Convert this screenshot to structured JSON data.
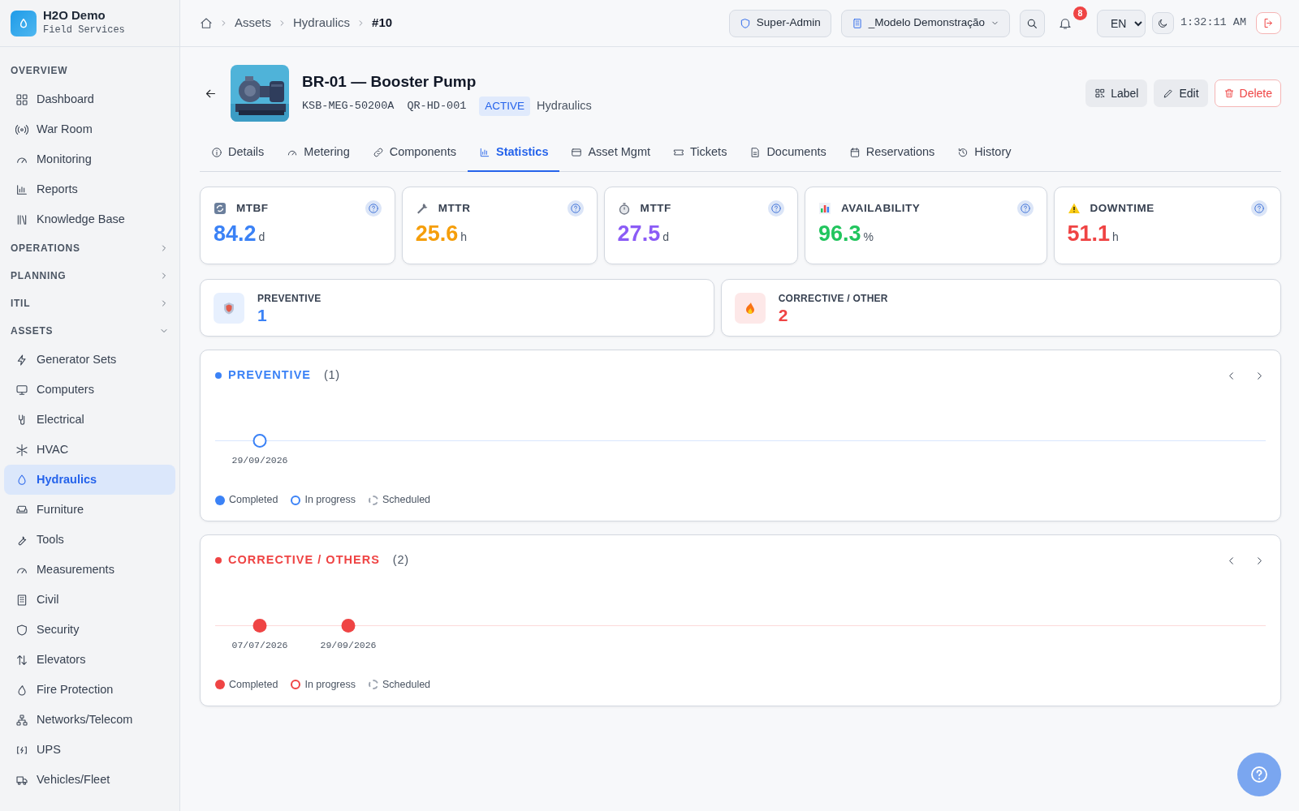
{
  "brand": {
    "name": "H2O Demo",
    "subtitle": "Field Services"
  },
  "sidebar": {
    "sections": [
      {
        "title": "OVERVIEW",
        "kind": "heading",
        "items": [
          {
            "label": "Dashboard",
            "selected": false
          },
          {
            "label": "War Room",
            "selected": false
          },
          {
            "label": "Monitoring",
            "selected": false
          },
          {
            "label": "Reports",
            "selected": false
          },
          {
            "label": "Knowledge Base",
            "selected": false
          }
        ]
      },
      {
        "title": "OPERATIONS",
        "kind": "group",
        "expanded": false
      },
      {
        "title": "PLANNING",
        "kind": "group",
        "expanded": false
      },
      {
        "title": "ITIL",
        "kind": "group",
        "expanded": false
      },
      {
        "title": "ASSETS",
        "kind": "group",
        "expanded": true,
        "items": [
          {
            "label": "Generator Sets",
            "selected": false
          },
          {
            "label": "Computers",
            "selected": false
          },
          {
            "label": "Electrical",
            "selected": false
          },
          {
            "label": "HVAC",
            "selected": false
          },
          {
            "label": "Hydraulics",
            "selected": true
          },
          {
            "label": "Furniture",
            "selected": false
          },
          {
            "label": "Tools",
            "selected": false
          },
          {
            "label": "Measurements",
            "selected": false
          },
          {
            "label": "Civil",
            "selected": false
          },
          {
            "label": "Security",
            "selected": false
          },
          {
            "label": "Elevators",
            "selected": false
          },
          {
            "label": "Fire Protection",
            "selected": false
          },
          {
            "label": "Networks/Telecom",
            "selected": false
          },
          {
            "label": "UPS",
            "selected": false
          },
          {
            "label": "Vehicles/Fleet",
            "selected": false
          }
        ]
      }
    ]
  },
  "breadcrumb": [
    "Assets",
    "Hydraulics",
    "#10"
  ],
  "topbar": {
    "role": "Super-Admin",
    "tenant": "_Modelo Demonstração",
    "notifications": "8",
    "language": "EN",
    "time": "1:32:11 AM"
  },
  "asset": {
    "title": "BR-01 — Booster Pump",
    "code": "KSB-MEG-50200A",
    "qr": "QR-HD-001",
    "status": "ACTIVE",
    "category": "Hydraulics"
  },
  "actions": [
    {
      "label": "Label",
      "kind": "neutral"
    },
    {
      "label": "Edit",
      "kind": "neutral"
    },
    {
      "label": "Delete",
      "kind": "danger"
    }
  ],
  "tabs": [
    {
      "label": "Details",
      "selected": false
    },
    {
      "label": "Metering",
      "selected": false
    },
    {
      "label": "Components",
      "selected": false
    },
    {
      "label": "Statistics",
      "selected": true
    },
    {
      "label": "Asset Mgmt",
      "selected": false
    },
    {
      "label": "Tickets",
      "selected": false
    },
    {
      "label": "Documents",
      "selected": false
    },
    {
      "label": "Reservations",
      "selected": false
    },
    {
      "label": "History",
      "selected": false
    }
  ],
  "kpis": [
    {
      "label": "MTBF",
      "value": "84.2",
      "unit": "d",
      "color": "#3b82f6"
    },
    {
      "label": "MTTR",
      "value": "25.6",
      "unit": "h",
      "color": "#f59e0b"
    },
    {
      "label": "MTTF",
      "value": "27.5",
      "unit": "d",
      "color": "#8b5cf6"
    },
    {
      "label": "AVAILABILITY",
      "value": "96.3",
      "unit": "%",
      "color": "#22c55e"
    },
    {
      "label": "DOWNTIME",
      "value": "51.1",
      "unit": "h",
      "color": "#ef4444"
    }
  ],
  "counts": [
    {
      "label": "PREVENTIVE",
      "value": "1",
      "color": "#3b82f6"
    },
    {
      "label": "CORRECTIVE / OTHER",
      "value": "2",
      "color": "#ef4444"
    }
  ],
  "timelines": [
    {
      "title": "PREVENTIVE",
      "count": "(1)",
      "color": "#3b82f6",
      "events": [
        {
          "date": "29/09/2026",
          "kind": "in_progress"
        }
      ],
      "legend": [
        {
          "label": "Completed",
          "kind": "completed"
        },
        {
          "label": "In progress",
          "kind": "in_progress"
        },
        {
          "label": "Scheduled",
          "kind": "scheduled"
        }
      ]
    },
    {
      "title": "CORRECTIVE / OTHERS",
      "count": "(2)",
      "color": "#ef4444",
      "events": [
        {
          "date": "07/07/2026",
          "kind": "completed"
        },
        {
          "date": "29/09/2026",
          "kind": "completed"
        }
      ],
      "legend": [
        {
          "label": "Completed",
          "kind": "completed"
        },
        {
          "label": "In progress",
          "kind": "in_progress"
        },
        {
          "label": "Scheduled",
          "kind": "scheduled"
        }
      ]
    }
  ]
}
